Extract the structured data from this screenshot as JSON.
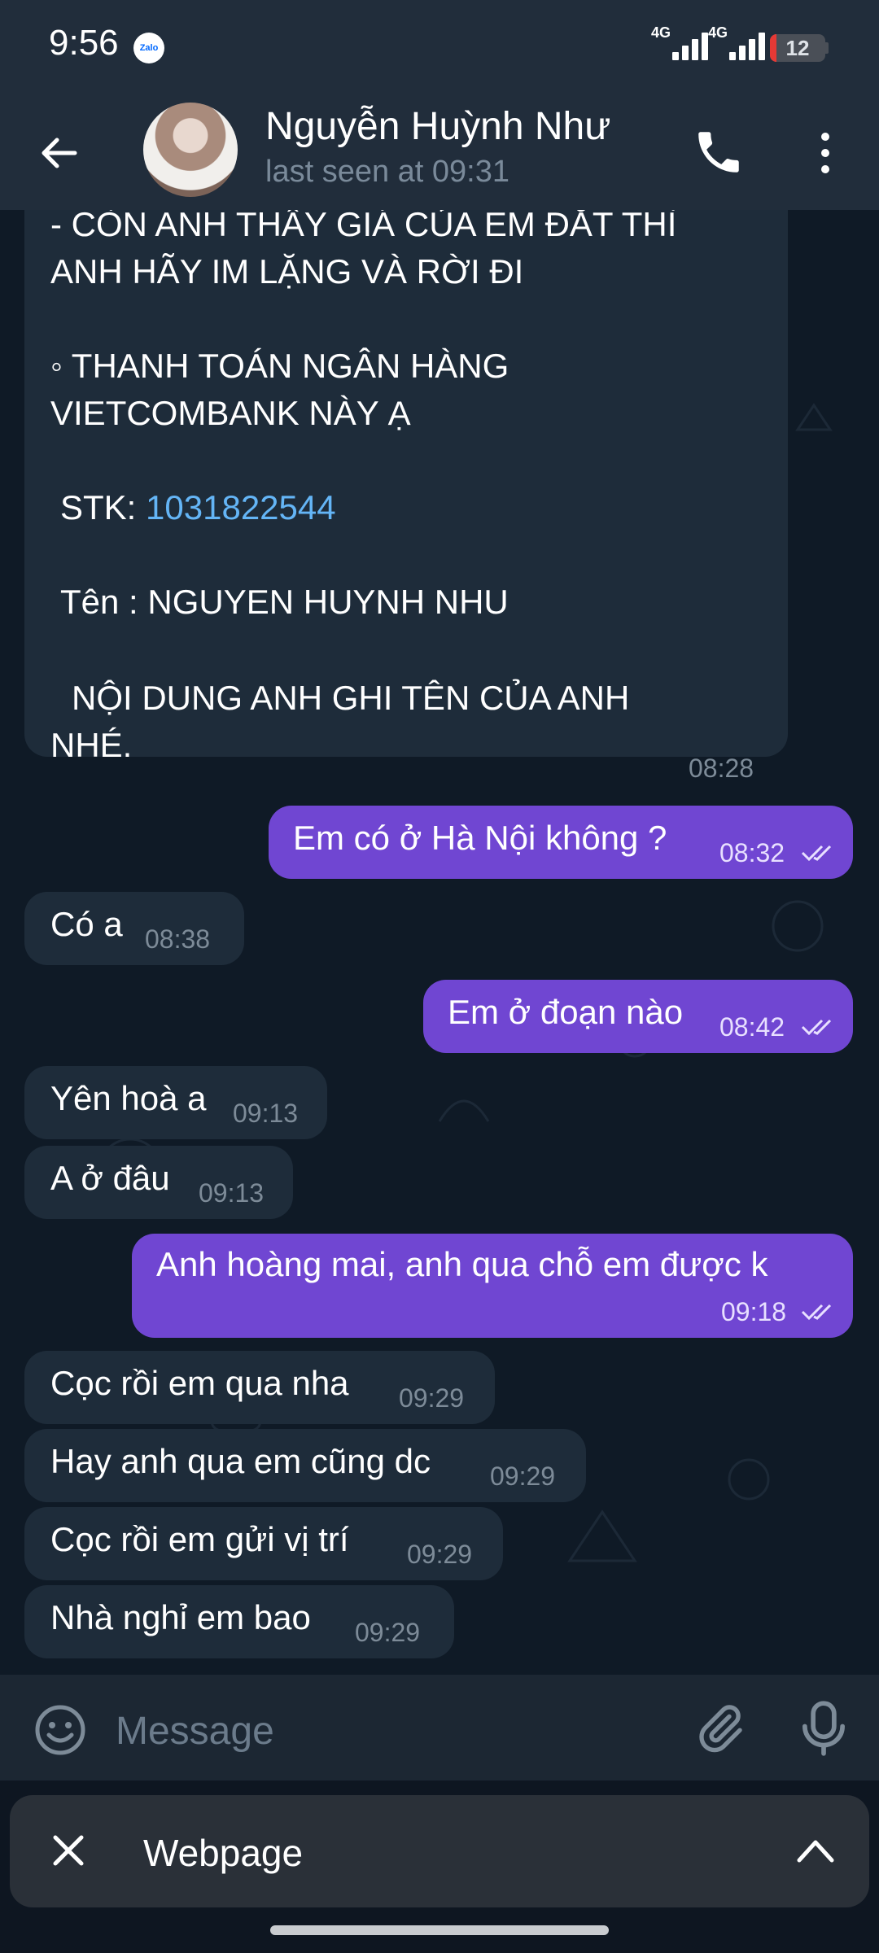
{
  "status_bar": {
    "time": "9:56",
    "app_icon_label": "Zalo",
    "network_1": "4G",
    "network_2": "4G",
    "battery": "12",
    "battery_color": "#e53935"
  },
  "header": {
    "contact_name": "Nguyễn Huỳnh Như",
    "last_seen": "last seen at 09:31"
  },
  "long_message": {
    "line_1": "- CÒN ANH THẤY GIÁ CỦA EM ĐẮT THÌ",
    "line_2": "ANH HÃY IM LẶNG VÀ RỜI ĐI",
    "line_3": "◦ THANH TOÁN  NGÂN HÀNG",
    "line_4": "VIETCOMBANK NÀY Ạ",
    "stk_label": "STK: ",
    "stk_value": "1031822544",
    "name_line": "Tên :   NGUYEN HUYNH NHU",
    "note_line_1": "NỘI DUNG ANH GHI TÊN  CỦA ANH",
    "note_line_2": "NHÉ.",
    "time": "08:28"
  },
  "messages": [
    {
      "direction": "out",
      "text": "Em có ở Hà Nội không ?",
      "time": "08:32",
      "read": true
    },
    {
      "direction": "in",
      "text": "Có a",
      "time": "08:38"
    },
    {
      "direction": "out",
      "text": "Em ở đoạn nào",
      "time": "08:42",
      "read": true
    },
    {
      "direction": "in",
      "text": "Yên hoà a",
      "time": "09:13"
    },
    {
      "direction": "in",
      "text": "A ở đâu",
      "time": "09:13"
    },
    {
      "direction": "out",
      "text": "Anh hoàng mai, anh qua chỗ em được k",
      "time": "09:18",
      "read": true
    },
    {
      "direction": "in",
      "text": "Cọc rồi em qua nha",
      "time": "09:29"
    },
    {
      "direction": "in",
      "text": "Hay anh qua em cũng dc",
      "time": "09:29"
    },
    {
      "direction": "in",
      "text": "Cọc rồi em gửi vị trí",
      "time": "09:29"
    },
    {
      "direction": "in",
      "text": "Nhà nghỉ em bao",
      "time": "09:29"
    }
  ],
  "composer": {
    "placeholder": "Message"
  },
  "webpage_bar": {
    "label": "Webpage"
  },
  "colors": {
    "outgoing_bubble": "#7046d2",
    "incoming_bubble": "#1e2c3a",
    "link": "#64b5f6"
  },
  "icons": [
    "back-arrow-icon",
    "phone-icon",
    "more-vert-icon",
    "emoji-icon",
    "paperclip-icon",
    "microphone-icon",
    "close-icon",
    "chevron-up-icon",
    "double-check-icon"
  ]
}
